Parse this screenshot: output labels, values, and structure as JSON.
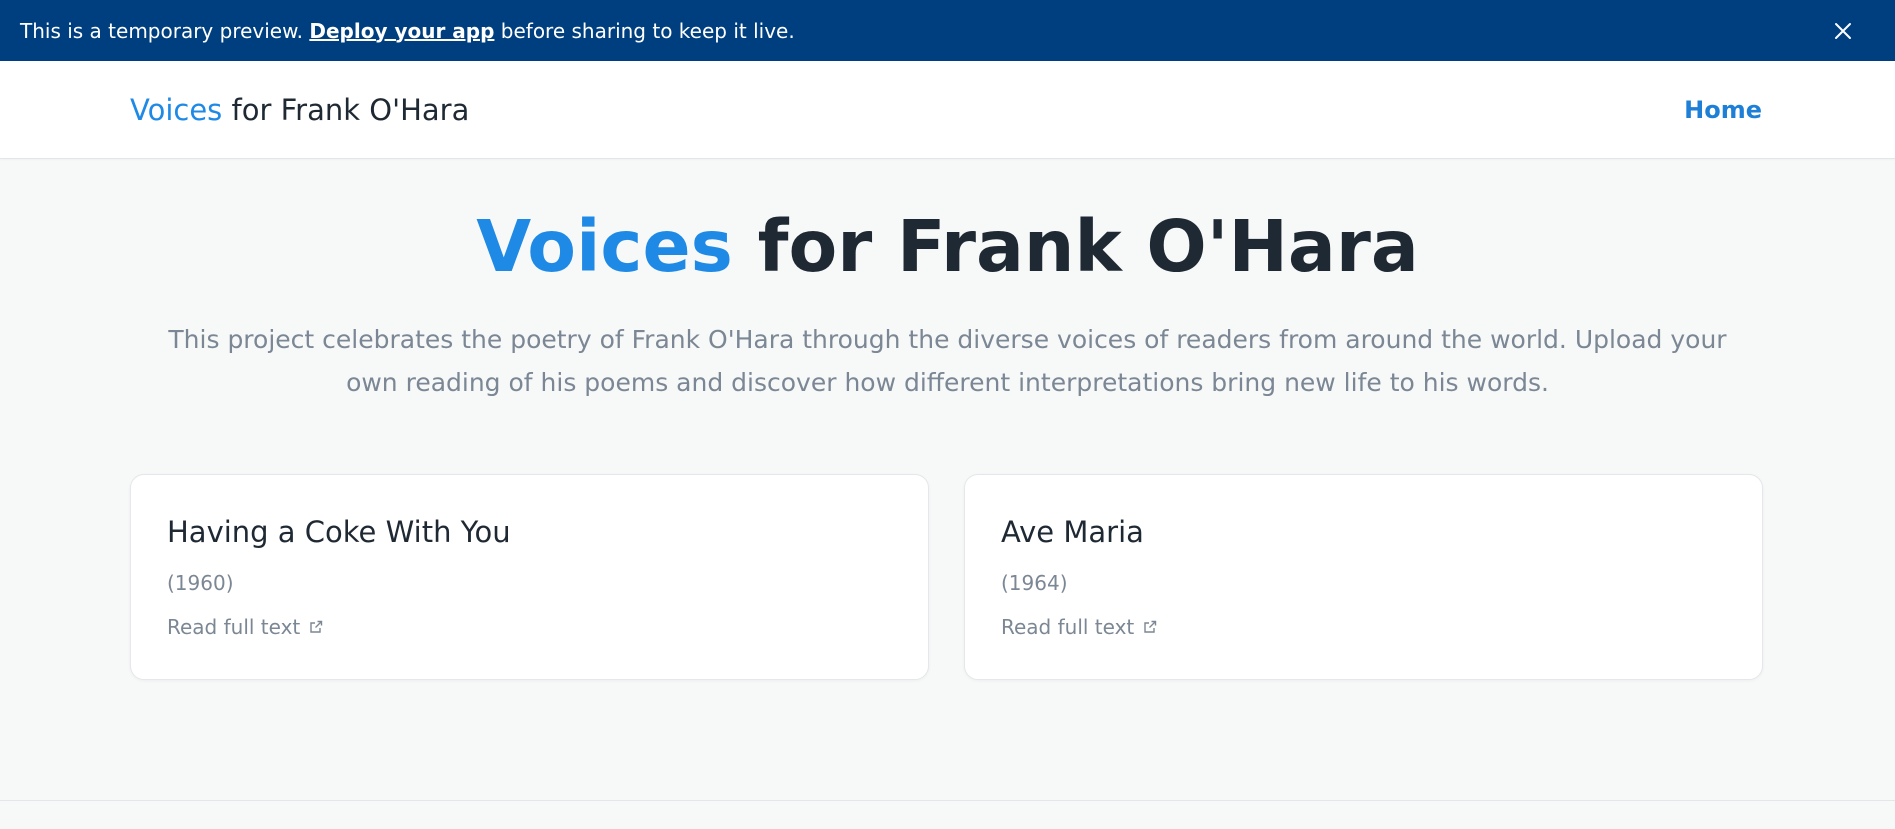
{
  "banner": {
    "prefix": "This is a temporary preview. ",
    "link_label": "Deploy your app",
    "suffix": " before sharing to keep it live.",
    "close_icon": "close-icon",
    "background_color": "#003f7f"
  },
  "navbar": {
    "brand_accent": "Voices",
    "brand_rest": " for Frank O'Hara",
    "home_label": "Home"
  },
  "hero": {
    "title_accent": "Voices",
    "title_rest": " for Frank O'Hara",
    "description": "This project celebrates the poetry of Frank O'Hara through the diverse voices of readers from around the world. Upload your own reading of his poems and discover how different interpretations bring new life to his words."
  },
  "poems": [
    {
      "title": "Having a Coke With You",
      "year": "(1960)",
      "link_label": "Read full text",
      "link_icon": "external-link-icon"
    },
    {
      "title": "Ave Maria",
      "year": "(1964)",
      "link_label": "Read full text",
      "link_icon": "external-link-icon"
    }
  ],
  "colors": {
    "accent": "#1e8ae6",
    "text": "#1f2933",
    "muted": "#7b8794"
  }
}
